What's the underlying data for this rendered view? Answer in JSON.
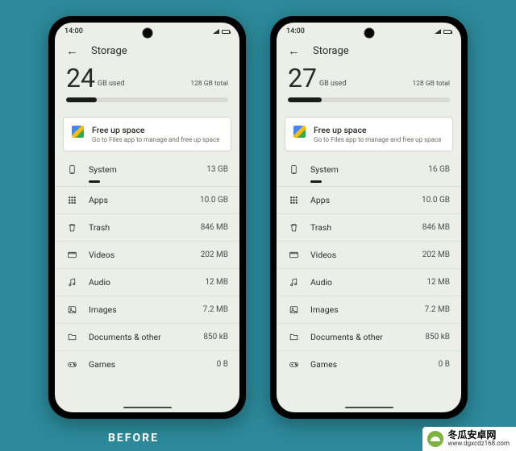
{
  "caption_before": "BEFORE",
  "watermark": {
    "name": "冬瓜安卓网",
    "url": "www.dgxcdz168.com"
  },
  "left": {
    "clock": "14:00",
    "title": "Storage",
    "used_number": "24",
    "used_unit": "GB used",
    "total": "128 GB total",
    "bar_pct": 19,
    "freeup": {
      "title": "Free up space",
      "subtitle": "Go to Files app to manage and free up space"
    },
    "items": [
      {
        "name": "System",
        "value": "13 GB",
        "icon": "phone"
      },
      {
        "name": "Apps",
        "value": "10.0 GB",
        "icon": "apps"
      },
      {
        "name": "Trash",
        "value": "846 MB",
        "icon": "trash"
      },
      {
        "name": "Videos",
        "value": "202 MB",
        "icon": "video"
      },
      {
        "name": "Audio",
        "value": "12 MB",
        "icon": "audio"
      },
      {
        "name": "Images",
        "value": "7.2 MB",
        "icon": "image"
      },
      {
        "name": "Documents & other",
        "value": "850 kB",
        "icon": "doc"
      },
      {
        "name": "Games",
        "value": "0 B",
        "icon": "game"
      }
    ]
  },
  "right": {
    "clock": "14:00",
    "title": "Storage",
    "used_number": "27",
    "used_unit": "GB used",
    "total": "128 GB total",
    "bar_pct": 21,
    "freeup": {
      "title": "Free up space",
      "subtitle": "Go to Files app to manage and free up space"
    },
    "items": [
      {
        "name": "System",
        "value": "16 GB",
        "icon": "phone"
      },
      {
        "name": "Apps",
        "value": "10.0 GB",
        "icon": "apps"
      },
      {
        "name": "Trash",
        "value": "846 MB",
        "icon": "trash"
      },
      {
        "name": "Videos",
        "value": "202 MB",
        "icon": "video"
      },
      {
        "name": "Audio",
        "value": "12 MB",
        "icon": "audio"
      },
      {
        "name": "Images",
        "value": "7.2 MB",
        "icon": "image"
      },
      {
        "name": "Documents & other",
        "value": "850 kB",
        "icon": "doc"
      },
      {
        "name": "Games",
        "value": "0 B",
        "icon": "game"
      }
    ]
  }
}
